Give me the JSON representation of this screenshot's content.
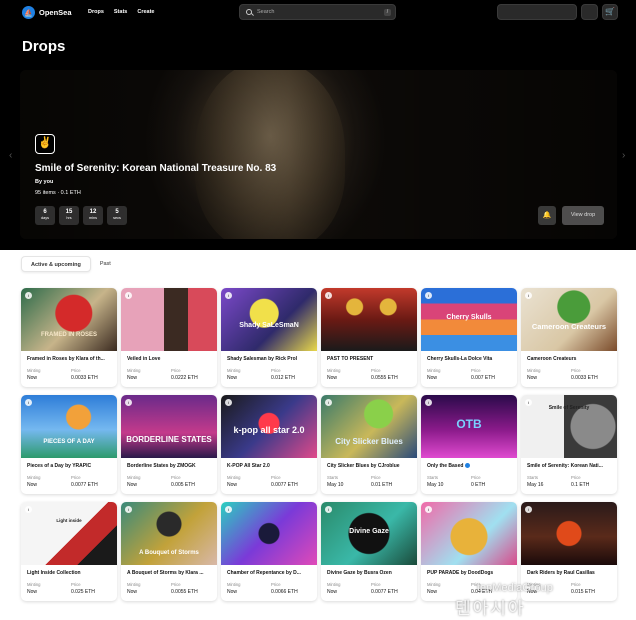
{
  "nav": {
    "brand": "OpenSea",
    "links": [
      "Drops",
      "Stats",
      "Create"
    ],
    "search_placeholder": "Search",
    "search_shortcut": "/"
  },
  "page_title": "Drops",
  "hero": {
    "title": "Smile of Serenity: Korean National Treasure No. 83",
    "by": "By you",
    "meta": "95 items · 0.1 ETH",
    "countdown": [
      {
        "value": "6",
        "unit": "days"
      },
      {
        "value": "15",
        "unit": "hrs"
      },
      {
        "value": "12",
        "unit": "mins"
      },
      {
        "value": "5",
        "unit": "secs"
      }
    ],
    "view_label": "View drop"
  },
  "tabs": [
    "Active & upcoming",
    "Past"
  ],
  "cards": [
    {
      "name": "Framed in Roses by Klara of th...",
      "label1": "Minting",
      "value1": "Now",
      "label2": "Price",
      "value2": "0.0033 ETH",
      "art_text": "FRAMED IN ROSES"
    },
    {
      "name": "Veiled in Love",
      "label1": "Minting",
      "value1": "Now",
      "label2": "Price",
      "value2": "0.0222 ETH",
      "art_text": ""
    },
    {
      "name": "Shady Salesman by Rick Prol",
      "label1": "Minting",
      "value1": "Now",
      "label2": "Price",
      "value2": "0.012 ETH",
      "art_text": "Shady SaLeSmaN"
    },
    {
      "name": "PAST TO PRESENT",
      "label1": "Minting",
      "value1": "Now",
      "label2": "Price",
      "value2": "0.0555 ETH",
      "art_text": ""
    },
    {
      "name": "Cherry Skulls-La Dolce Vita",
      "label1": "Minting",
      "value1": "Now",
      "label2": "Price",
      "value2": "0.007 ETH",
      "art_text": "Cherry Skulls"
    },
    {
      "name": "Cameroon Createurs",
      "label1": "Minting",
      "value1": "Now",
      "label2": "Price",
      "value2": "0.0033 ETH",
      "art_text": "Cameroon Createurs"
    },
    {
      "name": "Pieces of a Day by YRAPIC",
      "label1": "Minting",
      "value1": "Now",
      "label2": "Price",
      "value2": "0.0077 ETH",
      "art_text": "PIECES OF A DAY"
    },
    {
      "name": "Borderline States by ZMOGK",
      "label1": "Minting",
      "value1": "Now",
      "label2": "Price",
      "value2": "0.005 ETH",
      "art_text": "BORDERLINE STATES"
    },
    {
      "name": "K-POP All Star 2.0",
      "label1": "Minting",
      "value1": "Now",
      "label2": "Price",
      "value2": "0.0077 ETH",
      "art_text": "k-pop all star 2.0"
    },
    {
      "name": "City Slicker Blues by CJroblue",
      "label1": "Starts",
      "value1": "May 10",
      "label2": "Price",
      "value2": "0.01 ETH",
      "art_text": "City Slicker Blues"
    },
    {
      "name": "Only the Based",
      "label1": "Starts",
      "value1": "May 10",
      "label2": "Price",
      "value2": "0 ETH",
      "art_text": "OTB"
    },
    {
      "name": "Smile of Serenity: Korean Nati...",
      "label1": "Starts",
      "value1": "May 16",
      "label2": "Price",
      "value2": "0.1 ETH",
      "art_text": "Smile of Serenity"
    },
    {
      "name": "Light Inside Collection",
      "label1": "Minting",
      "value1": "Now",
      "label2": "Price",
      "value2": "0.025 ETH",
      "art_text": "Light inside"
    },
    {
      "name": "A Bouquet of Storms by Klara ...",
      "label1": "Minting",
      "value1": "Now",
      "label2": "Price",
      "value2": "0.0055 ETH",
      "art_text": "A Bouquet of Storms"
    },
    {
      "name": "Chamber of Repentance by D...",
      "label1": "Minting",
      "value1": "Now",
      "label2": "Price",
      "value2": "0.0066 ETH",
      "art_text": ""
    },
    {
      "name": "Divine Gaze by Busra Ozen",
      "label1": "Minting",
      "value1": "Now",
      "label2": "Price",
      "value2": "0.0077 ETH",
      "art_text": "Divine Gaze"
    },
    {
      "name": "PUP PARADE by DoodDogs",
      "label1": "Minting",
      "value1": "Now",
      "label2": "Price",
      "value2": "0.04 ETH",
      "art_text": ""
    },
    {
      "name": "Dark Riders by Raul Casillas",
      "label1": "Minting",
      "value1": "Now",
      "label2": "Price",
      "value2": "0.015 ETH",
      "art_text": ""
    }
  ],
  "watermark": {
    "line1": "tenMediaGroup",
    "line2": "텐아시아"
  },
  "colors": {
    "brand": "#2081e2",
    "header_bg": "#000000",
    "text": "#121212"
  }
}
